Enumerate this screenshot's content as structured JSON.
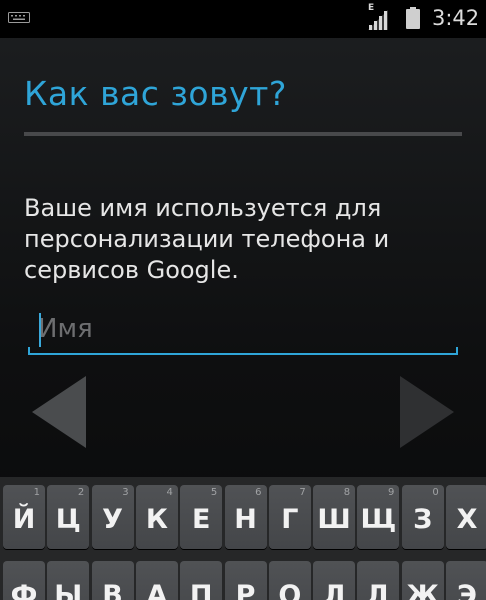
{
  "status_bar": {
    "time": "3:42",
    "network_type": "E",
    "icons": [
      "keyboard-icon",
      "signal-icon",
      "battery-icon"
    ]
  },
  "header": {
    "title": "Как вас зовут?"
  },
  "main": {
    "description": "Ваше имя используется для персонализации телефона и сервисов Google.",
    "name_input": {
      "placeholder": "Имя",
      "value": ""
    },
    "nav": {
      "back_icon": "triangle-left-icon",
      "next_icon": "triangle-right-icon"
    }
  },
  "keyboard": {
    "row1": [
      {
        "label": "Й",
        "hint": "1"
      },
      {
        "label": "Ц",
        "hint": "2"
      },
      {
        "label": "У",
        "hint": "3"
      },
      {
        "label": "К",
        "hint": "4"
      },
      {
        "label": "Е",
        "hint": "5"
      },
      {
        "label": "Н",
        "hint": "6"
      },
      {
        "label": "Г",
        "hint": "7"
      },
      {
        "label": "Ш",
        "hint": "8"
      },
      {
        "label": "Щ",
        "hint": "9"
      },
      {
        "label": "З",
        "hint": "0"
      },
      {
        "label": "Х",
        "hint": ""
      }
    ],
    "row2": [
      {
        "label": "Ф"
      },
      {
        "label": "Ы"
      },
      {
        "label": "В"
      },
      {
        "label": "А"
      },
      {
        "label": "П"
      },
      {
        "label": "Р"
      },
      {
        "label": "О"
      },
      {
        "label": "Л"
      },
      {
        "label": "Д"
      },
      {
        "label": "Ж"
      },
      {
        "label": "Э"
      }
    ]
  },
  "colors": {
    "accent": "#2fa5d8",
    "background": "#151617",
    "key": "#4a4c4f"
  }
}
